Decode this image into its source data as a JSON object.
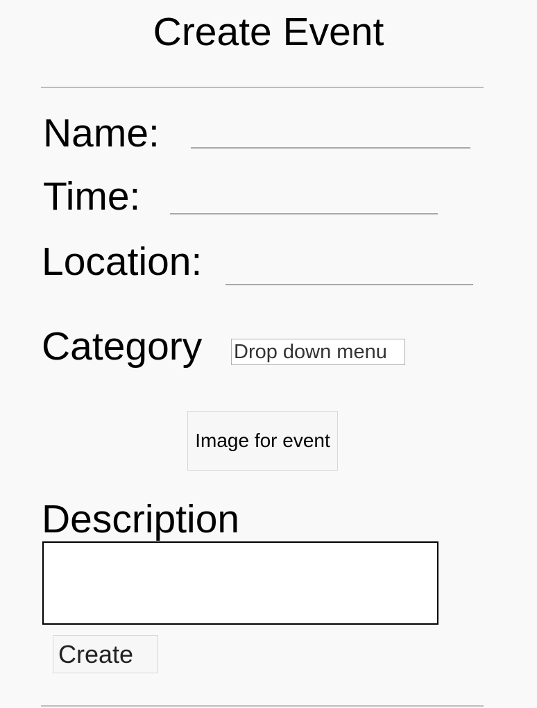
{
  "page": {
    "title": "Create Event"
  },
  "form": {
    "name_label": "Name:",
    "name_value": "",
    "time_label": "Time:",
    "time_value": "",
    "location_label": "Location:",
    "location_value": "",
    "category_label": "Category",
    "category_dropdown": "Drop down menu",
    "image_button": "Image for event",
    "description_label": "Description",
    "description_value": "",
    "create_button": "Create"
  }
}
